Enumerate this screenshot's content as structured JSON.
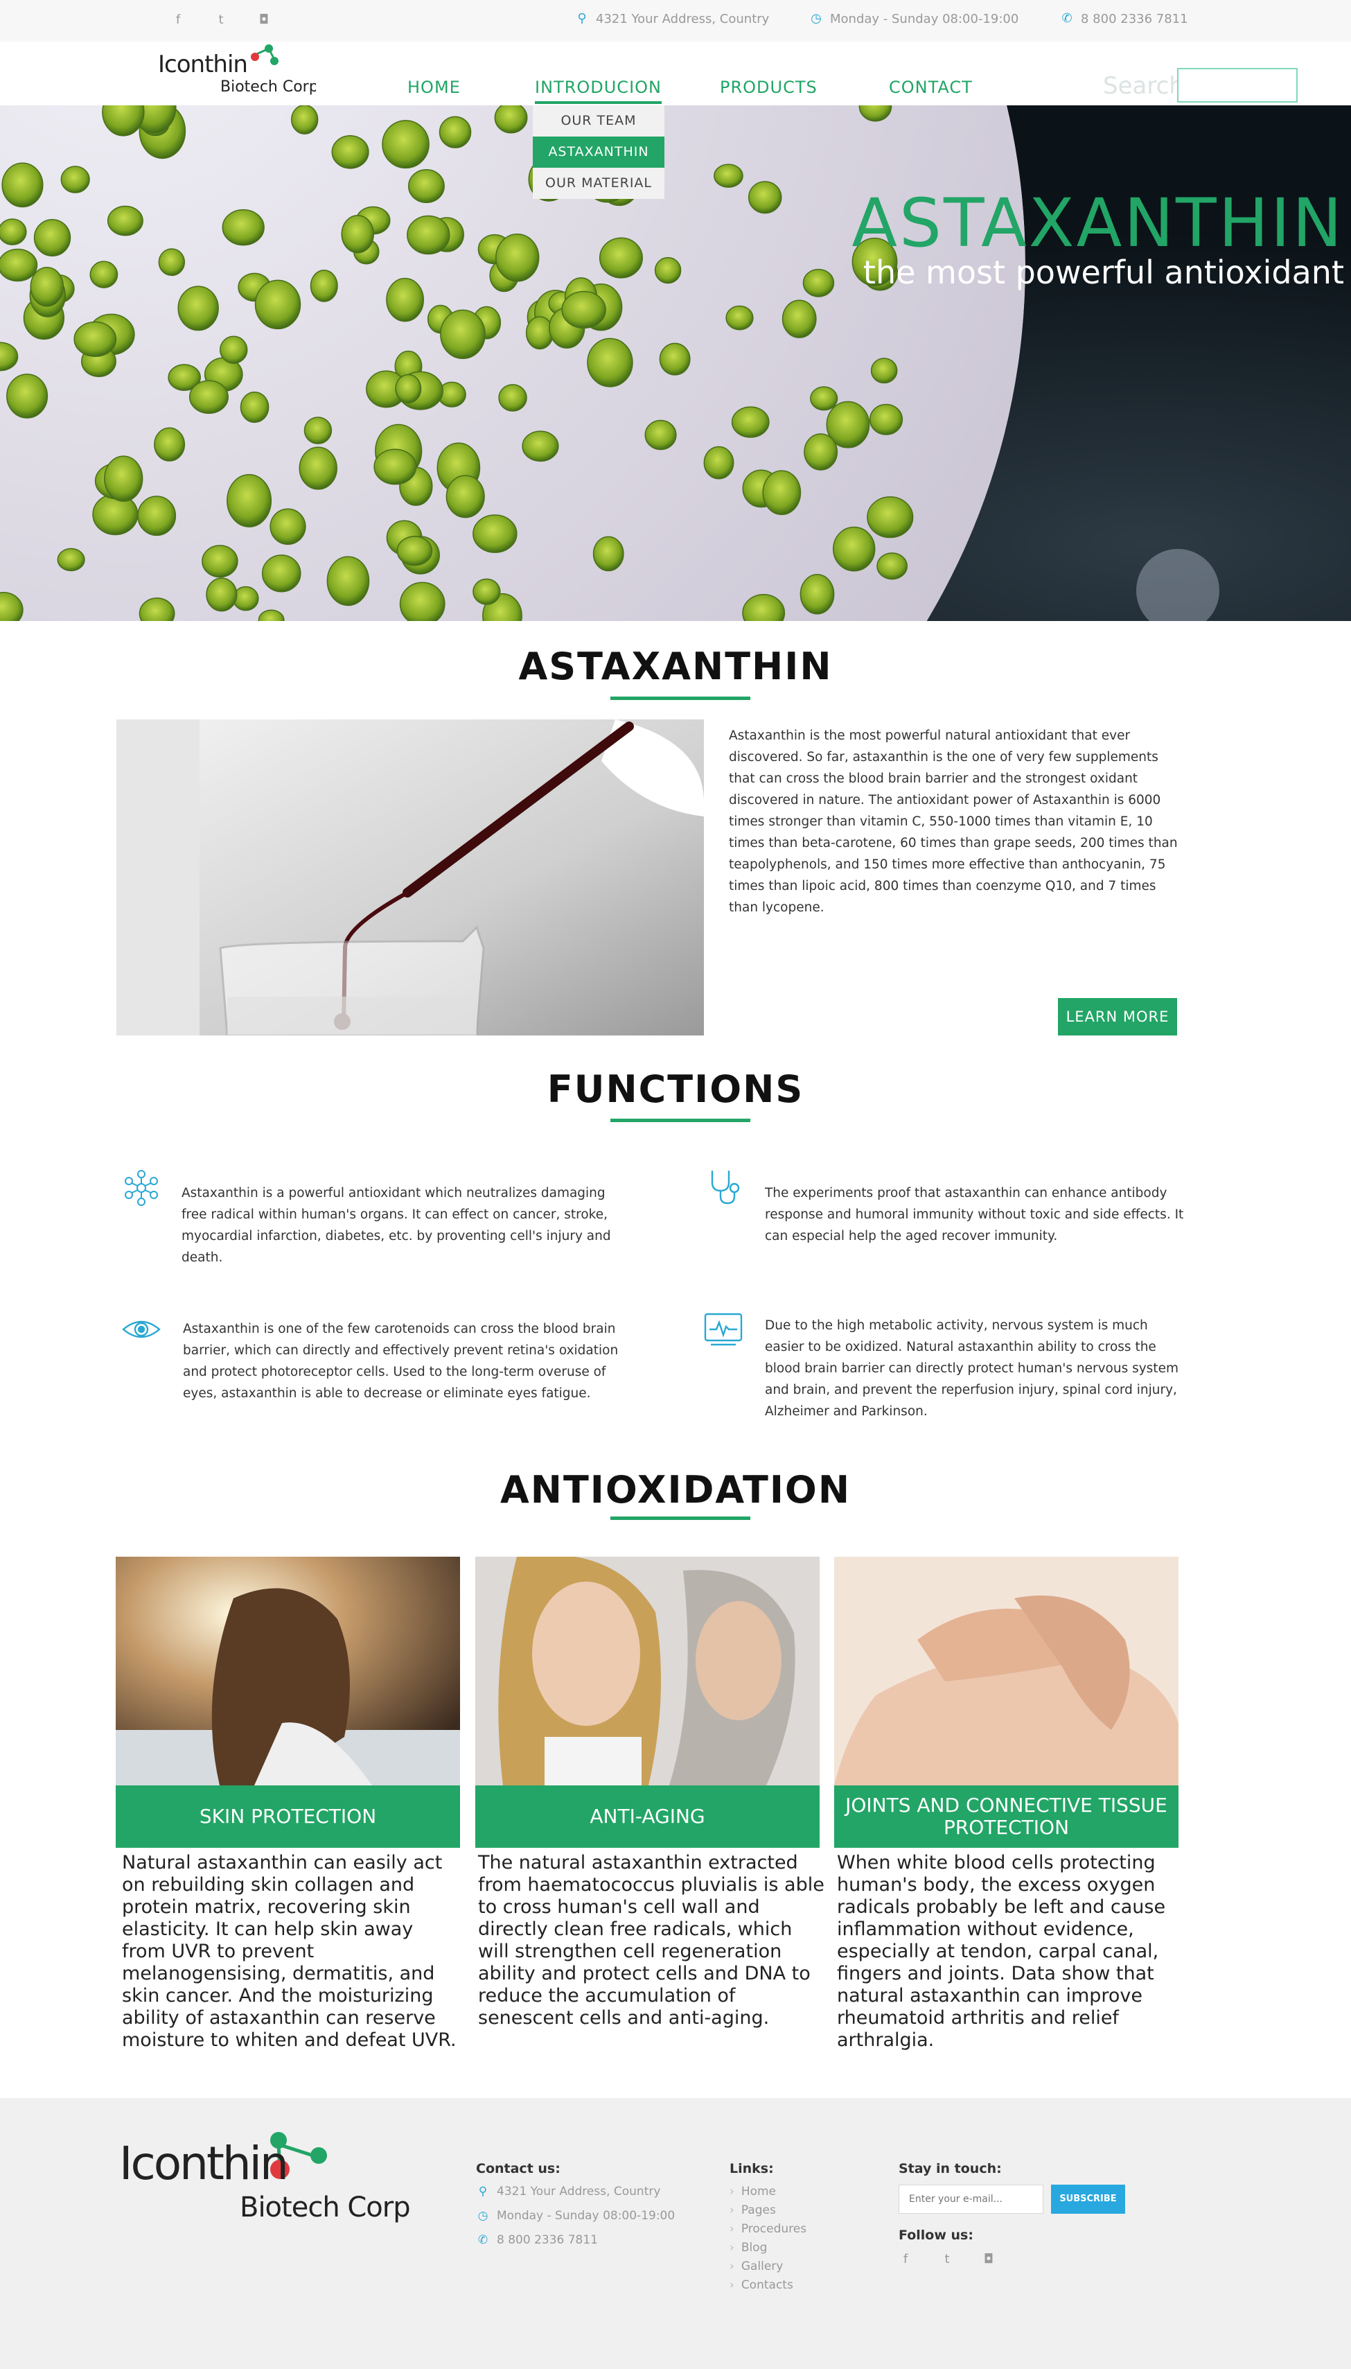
{
  "topbar": {
    "social": [
      {
        "icon": "facebook-icon",
        "glyph": "f"
      },
      {
        "icon": "twitter-icon",
        "glyph": "t"
      },
      {
        "icon": "instagram-icon",
        "glyph": "◘"
      }
    ],
    "address": "4321 Your Address, Country",
    "hours": "Monday - Sunday 08:00-19:00",
    "phone": "8 800 2336 7811"
  },
  "header": {
    "logo_word": "Iconthin",
    "logo_sub": "Biotech Corp.",
    "nav": [
      "HOME",
      "INTRODUCION",
      "PRODUCTS",
      "CONTACT"
    ],
    "active_nav": "INTRODUCION",
    "dropdown": [
      "OUR TEAM",
      "ASTAXANTHIN",
      "OUR MATERIAL"
    ],
    "dropdown_active": "ASTAXANTHIN",
    "search_label": "Search",
    "search_value": ""
  },
  "hero": {
    "title": "ASTAXANTHIN",
    "subtitle": "the most powerful antioxidant"
  },
  "about": {
    "title": "ASTAXANTHIN",
    "text": "Astaxanthin is the most powerful natural antioxidant that ever discovered. So far, astaxanthin is the one of very few supplements that can cross the blood brain barrier and the strongest oxidant discovered in nature. The antioxidant power of Astaxanthin is 6000 times stronger than vitamin C, 550-1000 times than vitamin E, 10 times than beta-carotene, 60 times than grape seeds, 200 times than teapolyphenols, and 150 times more effective than anthocyanin, 75 times than lipoic acid, 800 times than coenzyme Q10, and 7 times than lycopene.",
    "button": "LEARN MORE"
  },
  "functions": {
    "title": "FUNCTIONS",
    "items": [
      {
        "icon": "molecule-icon",
        "text": "Astaxanthin is a powerful antioxidant which neutralizes damaging free radical within human's organs. It can effect on cancer, stroke, myocardial infarction, diabetes, etc. by proventing cell's injury and death."
      },
      {
        "icon": "stethoscope-icon",
        "text": "The experiments proof that astaxanthin can enhance antibody response and humoral immunity without toxic and side effects. It can especial help the aged recover immunity."
      },
      {
        "icon": "eye-icon",
        "text": "Astaxanthin is one of the few carotenoids can cross the blood brain barrier, which can directly and effectively prevent retina's oxidation and protect photoreceptor cells. Used to the long-term overuse of eyes, astaxanthin is able to decrease or eliminate eyes fatigue."
      },
      {
        "icon": "heart-monitor-icon",
        "text": "Due to the high metabolic activity, nervous system is much easier to be oxidized. Natural astaxanthin ability to cross the blood brain barrier can directly protect human's nervous system and brain, and prevent the reperfusion injury, spinal cord injury, Alzheimer and Parkinson."
      }
    ]
  },
  "antioxidation": {
    "title": "ANTIOXIDATION",
    "cards": [
      {
        "title": "SKIN PROTECTION",
        "text": "Natural astaxanthin can easily act on rebuilding skin collagen and protein matrix, recovering skin elasticity. It can help skin away from UVR to prevent melanogensising, dermatitis, and skin cancer. And the moisturizing ability of astaxanthin can reserve moisture to whiten and defeat UVR."
      },
      {
        "title": "ANTI-AGING",
        "text": "The natural astaxanthin extracted from haematococcus pluvialis is able to cross human's cell wall and directly clean free radicals, which will strengthen cell regeneration ability and protect cells and DNA to reduce the accumulation of senescent cells and anti-aging."
      },
      {
        "title": "JOINTS AND CONNECTIVE TISSUE PROTECTION",
        "text": "When white blood cells protecting human's body, the excess oxygen radicals probably be left and cause inflammation without evidence, especially at tendon, carpal canal, fingers and joints. Data show that natural astaxanthin can improve rheumatoid arthritis and relief arthralgia."
      }
    ]
  },
  "footer": {
    "logo_word": "Iconthin",
    "logo_sub": "Biotech Corp.",
    "contact_heading": "Contact us:",
    "address": "4321 Your Address, Country",
    "hours": "Monday - Sunday 08:00-19:00",
    "phone": "8 800 2336 7811",
    "links_heading": "Links:",
    "links": [
      "Home",
      "Pages",
      "Procedures",
      "Blog",
      "Gallery",
      "Contacts"
    ],
    "stay_heading": "Stay in touch:",
    "email_placeholder": "Enter your e-mail...",
    "subscribe": "SUBSCRIBE",
    "follow_heading": "Follow us:"
  },
  "colors": {
    "accent_green": "#22a566",
    "info_blue": "#29a8d3",
    "subscribe_blue": "#29a8e0",
    "logo_red": "#e03a3e"
  }
}
